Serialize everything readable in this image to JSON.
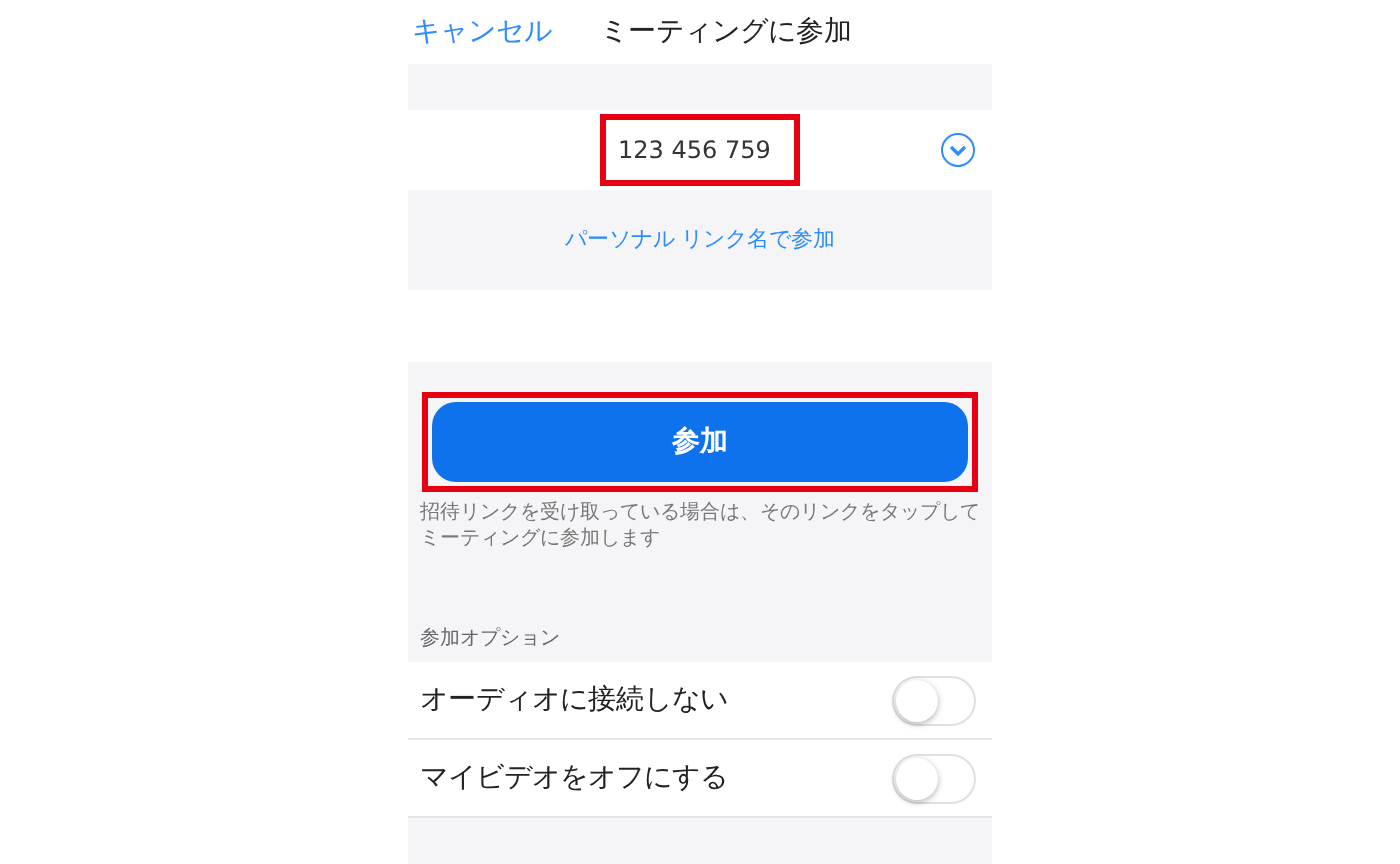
{
  "header": {
    "cancel": "キャンセル",
    "title": "ミーティングに参加"
  },
  "meeting_id": {
    "value": "123 456 759"
  },
  "personal_link": "パーソナル リンク名で参加",
  "join_button": "参加",
  "help_text": "招待リンクを受け取っている場合は、そのリンクをタップしてミーティングに参加します",
  "options": {
    "heading": "参加オプション",
    "items": [
      {
        "label": "オーディオに接続しない",
        "on": false
      },
      {
        "label": "マイビデオをオフにする",
        "on": false
      }
    ]
  }
}
